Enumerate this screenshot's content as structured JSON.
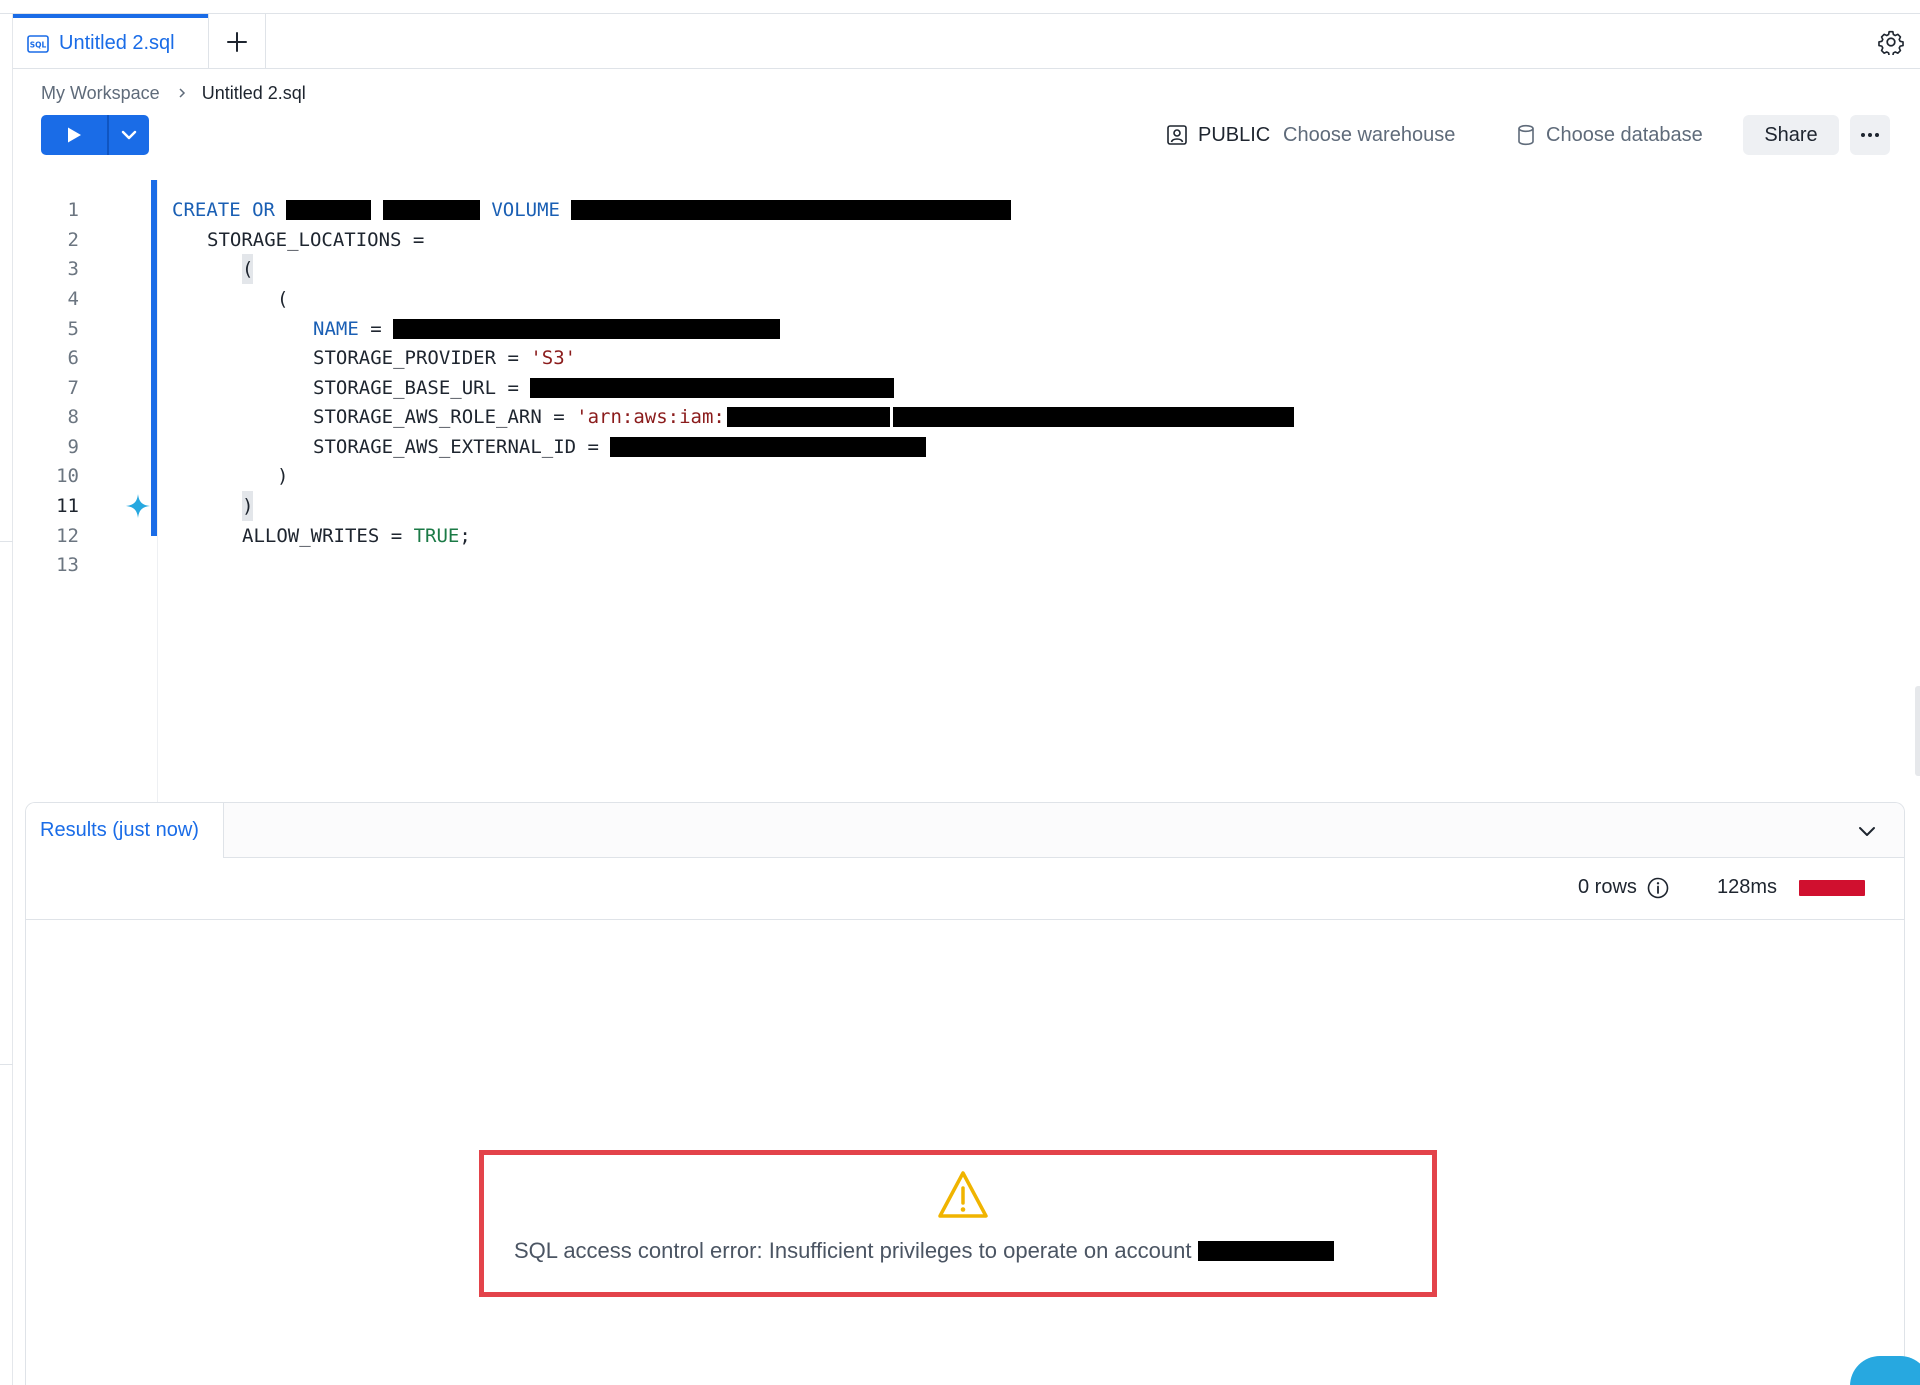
{
  "tabs": [
    {
      "label": "Untitled 2.sql",
      "active": true
    }
  ],
  "breadcrumb": {
    "root": "My Workspace",
    "current": "Untitled 2.sql"
  },
  "toolbar": {
    "role": "PUBLIC",
    "warehouse_placeholder": "Choose warehouse",
    "database_placeholder": "Choose database",
    "share_label": "Share",
    "more_label": "⋯"
  },
  "editor": {
    "line_numbers": [
      "1",
      "2",
      "3",
      "4",
      "5",
      "6",
      "7",
      "8",
      "9",
      "10",
      "11",
      "12",
      "13"
    ],
    "active_line": 11,
    "code": {
      "l1_create": "CREATE",
      "l1_or": "OR",
      "l1_volume": "VOLUME",
      "l2": "STORAGE_LOCATIONS =",
      "l3": "(",
      "l4": "(",
      "l5_kw": "NAME",
      "l5_eq": "=",
      "l6_key": "STORAGE_PROVIDER =",
      "l6_val": "'S3'",
      "l7_key": "STORAGE_BASE_URL =",
      "l8_key": "STORAGE_AWS_ROLE_ARN =",
      "l8_val": "'arn:aws:iam:",
      "l9_key": "STORAGE_AWS_EXTERNAL_ID =",
      "l10": ")",
      "l11": ")",
      "l12_key": "ALLOW_WRITES =",
      "l12_val": "TRUE",
      "l12_end": ";"
    }
  },
  "results": {
    "tab_label": "Results (just now)",
    "rows": "0 rows",
    "duration": "128ms",
    "error_message": "SQL access control error: Insufficient privileges to operate on account",
    "status_color": "#d0102f"
  },
  "colors": {
    "accent": "#1a6ce7",
    "error_border": "#e3434a",
    "warning": "#f0b400"
  }
}
